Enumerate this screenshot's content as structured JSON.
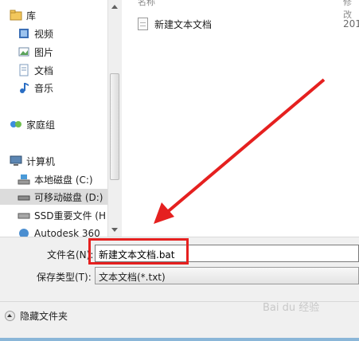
{
  "nav": {
    "items": [
      {
        "label": "库",
        "icon": "library-icon"
      },
      {
        "label": "视频",
        "icon": "video-icon"
      },
      {
        "label": "图片",
        "icon": "picture-icon"
      },
      {
        "label": "文档",
        "icon": "document-icon"
      },
      {
        "label": "音乐",
        "icon": "music-icon"
      },
      {
        "label": "家庭组",
        "icon": "homegroup-icon"
      },
      {
        "label": "计算机",
        "icon": "computer-icon"
      },
      {
        "label": "本地磁盘 (C:)",
        "icon": "local-disk-icon"
      },
      {
        "label": "可移动磁盘 (D:)",
        "icon": "removable-disk-icon"
      },
      {
        "label": "SSD重要文件 (H",
        "icon": "ssd-drive-icon"
      },
      {
        "label": "Autodesk 360",
        "icon": "autodesk-icon"
      }
    ]
  },
  "files": {
    "name_header": "名称",
    "date_header": "修改",
    "rows": [
      {
        "name": "新建文本文档",
        "date": "201"
      }
    ]
  },
  "form": {
    "filename_label": "文件名(N):",
    "filename_value": "新建文本文档.bat",
    "filetype_label": "保存类型(T):",
    "filetype_value": "文本文档(*.txt)"
  },
  "footer": {
    "hide_folders": "隐藏文件夹"
  },
  "watermark": "Bai du 经验",
  "colors": {
    "highlight_red": "#e5201f",
    "selected_bg": "#dcdcdc"
  }
}
